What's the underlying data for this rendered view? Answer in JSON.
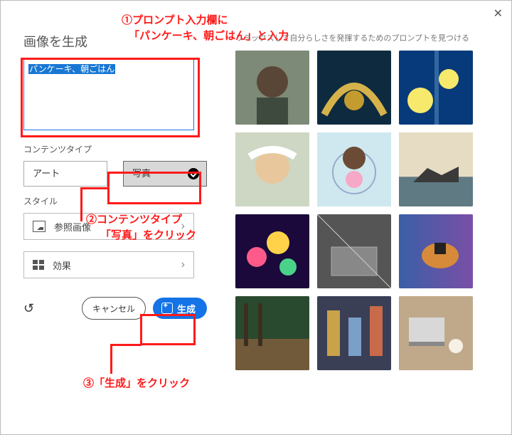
{
  "window": {
    "close": "✕"
  },
  "left": {
    "title": "画像を生成",
    "prompt_value": "パンケーキ、朝ごはん",
    "content_type_label": "コンテンツタイプ",
    "type_art": "アート",
    "type_photo": "写真",
    "style_label": "スタイル",
    "ref_image": "参照画像",
    "effects": "効果",
    "cancel": "キャンセル",
    "generate": "生成"
  },
  "right": {
    "subtitle": "リミックスして自分らしさを発揮するためのプロンプトを見つける"
  },
  "annotations": {
    "a1_line1": "①プロンプト入力欄に",
    "a1_line2": "「パンケーキ、朝ごはん」と入力",
    "a2_line1": "②コンテンツタイプ",
    "a2_line2": "「写真」をクリック",
    "a3": "③「生成」をクリック"
  }
}
